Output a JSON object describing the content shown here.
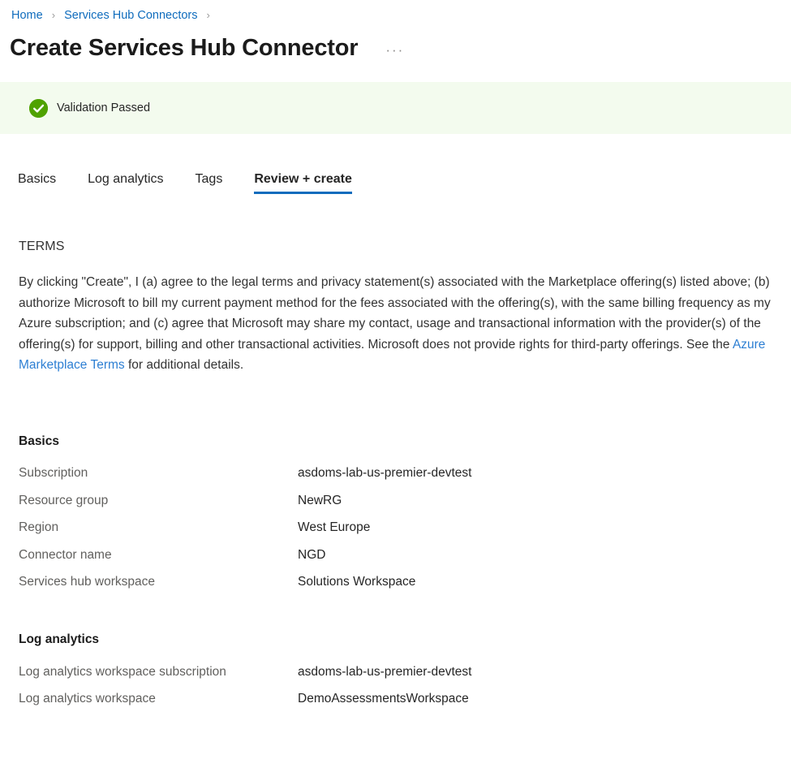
{
  "breadcrumb": {
    "items": [
      {
        "label": "Home"
      },
      {
        "label": "Services Hub Connectors"
      }
    ],
    "separator": "›"
  },
  "header": {
    "title": "Create Services Hub Connector",
    "more_actions": "···"
  },
  "banner": {
    "status": "Validation Passed",
    "icon": "check-circle-icon",
    "background_color": "#f3fbee",
    "icon_color": "#4fa200"
  },
  "tabs": [
    {
      "label": "Basics",
      "active": false
    },
    {
      "label": "Log analytics",
      "active": false
    },
    {
      "label": "Tags",
      "active": false
    },
    {
      "label": "Review + create",
      "active": true
    }
  ],
  "terms": {
    "heading": "TERMS",
    "body_before_link": "By clicking \"Create\", I (a) agree to the legal terms and privacy statement(s) associated with the Marketplace offering(s) listed above; (b) authorize Microsoft to bill my current payment method for the fees associated with the offering(s), with the same billing frequency as my Azure subscription; and (c) agree that Microsoft may share my contact, usage and transactional information with the provider(s) of the offering(s) for support, billing and other transactional activities. Microsoft does not provide rights for third-party offerings. See the ",
    "link_text": "Azure Marketplace Terms",
    "body_after_link": " for additional details."
  },
  "sections": {
    "basics": {
      "title": "Basics",
      "rows": [
        {
          "key": "Subscription",
          "value": "asdoms-lab-us-premier-devtest"
        },
        {
          "key": "Resource group",
          "value": "NewRG"
        },
        {
          "key": "Region",
          "value": "West Europe"
        },
        {
          "key": "Connector name",
          "value": "NGD"
        },
        {
          "key": "Services hub workspace",
          "value": "Solutions Workspace"
        }
      ]
    },
    "log_analytics": {
      "title": "Log analytics",
      "rows": [
        {
          "key": "Log analytics workspace subscription",
          "value": "asdoms-lab-us-premier-devtest"
        },
        {
          "key": "Log analytics workspace",
          "value": "DemoAssessmentsWorkspace"
        }
      ]
    }
  },
  "colors": {
    "accent": "#0f6cbd",
    "link": "#2d7fd3",
    "success": "#4fa200",
    "success_bg": "#f3fbee",
    "label_grey": "#61605e"
  }
}
